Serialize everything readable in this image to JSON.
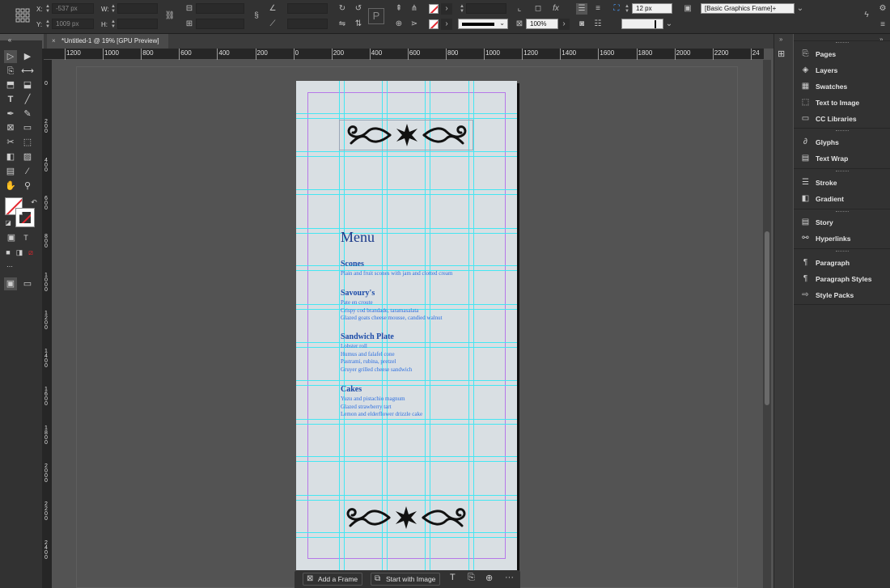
{
  "control_bar": {
    "x_label": "X:",
    "x_value": "-537 px",
    "y_label": "Y:",
    "y_value": "1009 px",
    "w_label": "W:",
    "h_label": "H:",
    "zoom_value": "100%",
    "stroke_weight": "12 px",
    "object_style": "[Basic Graphics Frame]+"
  },
  "document": {
    "tab_title": "*Untitled-1 @ 19% [GPU Preview]",
    "close_glyph": "×"
  },
  "ruler_h": [
    "1200",
    "1000",
    "800",
    "600",
    "400",
    "200",
    "0",
    "200",
    "400",
    "600",
    "800",
    "1000",
    "1200",
    "1400",
    "1600",
    "1800",
    "2000",
    "2200",
    "24"
  ],
  "ruler_v": [
    "0",
    "2\n0\n0",
    "4\n0\n0",
    "6\n0\n0",
    "8\n0\n0",
    "1\n0\n0\n0",
    "1\n2\n0\n0",
    "1\n4\n0\n0",
    "1\n6\n0\n0",
    "1\n8\n0\n0",
    "2\n0\n0\n0",
    "2\n2\n0\n0",
    "2\n4\n0\n0"
  ],
  "menu": {
    "title": "Menu",
    "sections": [
      {
        "heading": "Scones",
        "items": [
          "Plain and fruit scones with jam and clotted cream"
        ]
      },
      {
        "heading": "Savoury's",
        "items": [
          "Pate en croute",
          "Crispy cod brandade, taramasalata",
          "Glazed goats cheese mousse, candied walnut"
        ]
      },
      {
        "heading": "Sandwich Plate",
        "items": [
          "Lobster roll",
          "Humus and falafel cone",
          "Pastrami, rubina, pretzel",
          "Gruyer grilled cheese sandwich"
        ]
      },
      {
        "heading": "Cakes",
        "items": [
          "Yuzu and pistachio magnum",
          "Glazed strawberry tart",
          "Lemon and elderflower drizzle cake"
        ]
      }
    ]
  },
  "taskbar": {
    "add_frame": "Add a Frame",
    "start_with_image": "Start with Image",
    "more": "···"
  },
  "panels": [
    {
      "label": "Pages",
      "icon": "pages-icon"
    },
    {
      "label": "Layers",
      "icon": "layers-icon"
    },
    {
      "label": "Swatches",
      "icon": "swatches-icon"
    },
    {
      "label": "Text to Image",
      "icon": "text-to-image-icon"
    },
    {
      "label": "CC Libraries",
      "icon": "cc-libraries-icon"
    },
    {
      "label": "Glyphs",
      "icon": "glyphs-icon"
    },
    {
      "label": "Text Wrap",
      "icon": "text-wrap-icon"
    },
    {
      "label": "Stroke",
      "icon": "stroke-icon"
    },
    {
      "label": "Gradient",
      "icon": "gradient-icon"
    },
    {
      "label": "Story",
      "icon": "story-icon"
    },
    {
      "label": "Hyperlinks",
      "icon": "hyperlinks-icon"
    },
    {
      "label": "Paragraph",
      "icon": "paragraph-icon"
    },
    {
      "label": "Paragraph Styles",
      "icon": "paragraph-styles-icon"
    },
    {
      "label": "Style Packs",
      "icon": "style-packs-icon"
    }
  ],
  "colors": {
    "guide": "#45e6f2",
    "margin": "#b678e8",
    "menu_title": "#1b3a8a",
    "menu_text": "#2d6fe0",
    "fill_none": "#e3262e"
  }
}
